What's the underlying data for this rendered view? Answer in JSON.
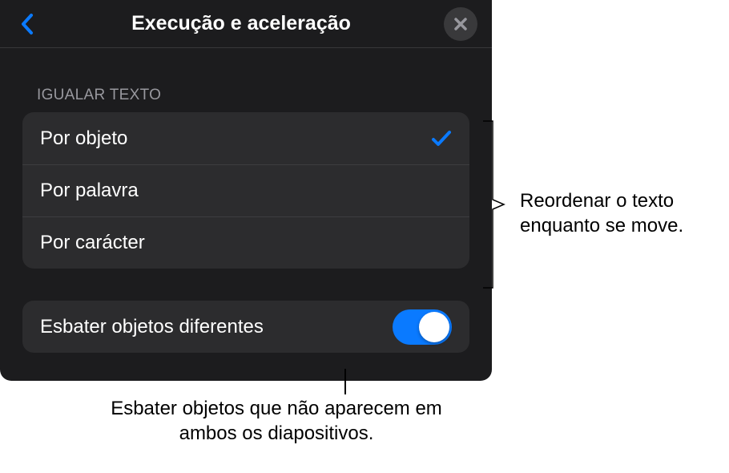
{
  "header": {
    "title": "Execução e aceleração"
  },
  "section": {
    "header": "IGUALAR TEXTO",
    "items": [
      {
        "label": "Por objeto",
        "selected": true
      },
      {
        "label": "Por palavra",
        "selected": false
      },
      {
        "label": "Por carácter",
        "selected": false
      }
    ]
  },
  "switch": {
    "label": "Esbater objetos diferentes",
    "on": true
  },
  "annotations": {
    "right": "Reordenar o texto enquanto se move.",
    "bottom": "Esbater objetos que não aparecem em ambos os diapositivos."
  }
}
